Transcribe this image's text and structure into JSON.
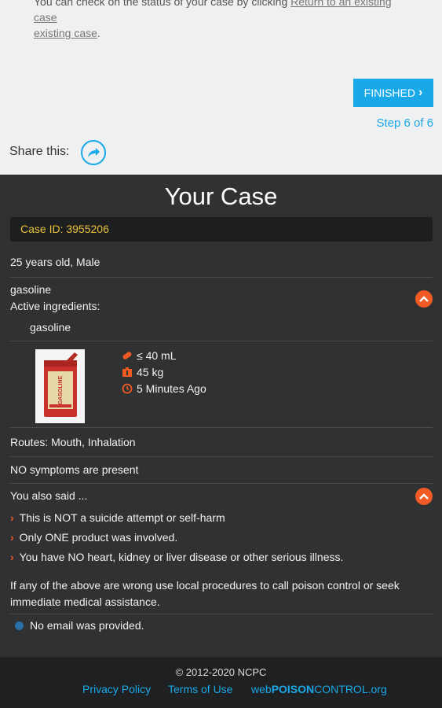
{
  "top": {
    "partial_text_line1": "You can check on the status of your case by clicking",
    "partial_text_link": "Return to an existing case",
    "partial_text_line2": "existing case",
    "partial_text_end": ".",
    "finished_label": "FINISHED",
    "step_label": "Step 6 of 6",
    "share_label": "Share this:"
  },
  "case": {
    "title": "Your Case",
    "case_id": "Case ID: 3955206",
    "patient": "25 years old, Male",
    "product_name": "gasoline",
    "active_ingredients_label": "Active ingredients:",
    "ingredient": "gasoline",
    "amount": "≤ 40 mL",
    "weight": "45 kg",
    "time": "5 Minutes Ago",
    "routes": "Routes: Mouth, Inhalation",
    "symptoms": "NO symptoms are present",
    "also_said_label": "You also said ...",
    "statements": [
      "This is NOT a suicide attempt or self-harm",
      "Only ONE product was involved.",
      "You have NO heart, kidney or liver disease or other serious illness."
    ],
    "warning_line1": "If any of the above are wrong use local procedures to call poison control or seek",
    "warning_line2": "immediate medical assistance.",
    "email_note": "No email was provided."
  },
  "footer": {
    "copyright": "© 2012-2020 NCPC",
    "privacy": "Privacy Policy",
    "terms": "Terms of Use",
    "brand_web": "web",
    "brand_poison": "POISON",
    "brand_control": "CONTROL.org"
  },
  "colors": {
    "accent_blue": "#1aa9e8",
    "accent_orange": "#f15a24",
    "case_id_yellow": "#e8c33a"
  }
}
